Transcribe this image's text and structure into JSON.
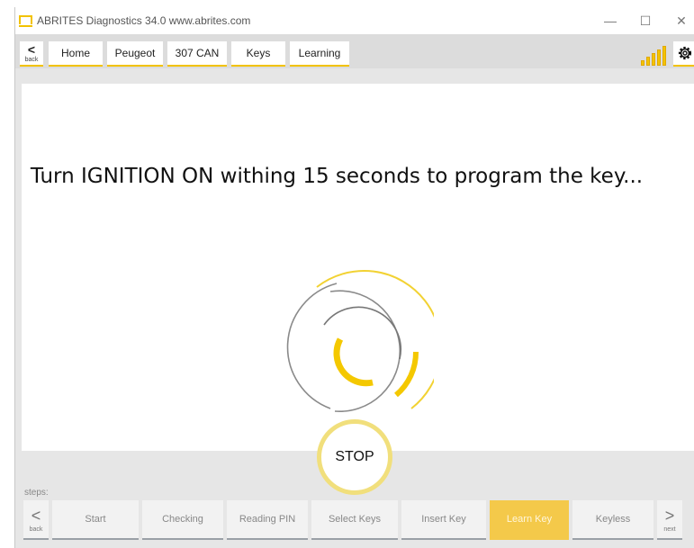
{
  "window": {
    "title": "ABRITES Diagnostics 34.0  www.abrites.com",
    "minimize": "—",
    "maximize": "☐",
    "close": "✕"
  },
  "nav": {
    "back_glyph": "<",
    "back_label": "back",
    "breadcrumbs": [
      "Home",
      "Peugeot",
      "307 CAN",
      "Keys",
      "Learning"
    ],
    "signal_icon": "signal-bars-icon",
    "settings_icon": "gear-icon"
  },
  "main": {
    "message": "Turn IGNITION ON withing 15 seconds to program the key...",
    "spinner_icon": "loading-spinner-icon",
    "stop_label": "STOP"
  },
  "steps": {
    "label": "steps:",
    "back_glyph": "<",
    "back_label": "back",
    "next_glyph": ">",
    "next_label": "next",
    "items": [
      "Start",
      "Checking",
      "Reading PIN",
      "Select Keys",
      "Insert Key",
      "Learn Key",
      "Keyless"
    ],
    "active": "Learn Key"
  },
  "colors": {
    "accent": "#f2c200",
    "active_step": "#f4c94a",
    "stop_ring": "#f1df7c"
  }
}
